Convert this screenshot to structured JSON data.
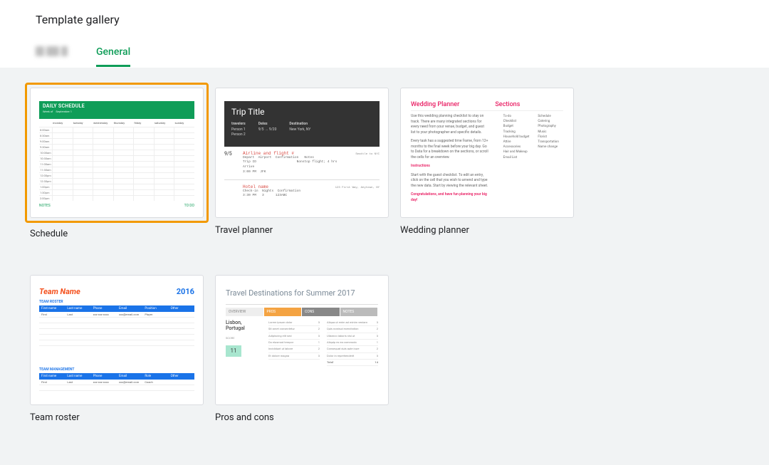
{
  "header": {
    "title": "Template gallery"
  },
  "tabs": [
    {
      "label": "",
      "blurred": true,
      "active": false
    },
    {
      "label": "General",
      "blurred": false,
      "active": true
    }
  ],
  "templates": [
    {
      "id": "schedule",
      "label": "Schedule",
      "selected": true,
      "thumb": {
        "kind": "schedule",
        "title": "DAILY SCHEDULE",
        "accent": "#0f9d58"
      }
    },
    {
      "id": "travel-planner",
      "label": "Travel planner",
      "selected": false,
      "thumb": {
        "kind": "travel",
        "title": "Trip Title",
        "date": "9/5",
        "sections": [
          "Airline and flight #",
          "Hotel name"
        ]
      }
    },
    {
      "id": "wedding-planner",
      "label": "Wedding planner",
      "selected": false,
      "thumb": {
        "kind": "wedding",
        "title": "Wedding Planner",
        "sections_label": "Sections",
        "accent": "#e91e63"
      }
    },
    {
      "id": "team-roster",
      "label": "Team roster",
      "selected": false,
      "thumb": {
        "kind": "roster",
        "team": "Team Name",
        "year": "2016",
        "section1": "TEAM ROSTER",
        "section2": "TEAM MANAGEMENT",
        "columns": [
          "First name",
          "Last name",
          "Phone",
          "Email",
          "Position",
          "Other"
        ]
      }
    },
    {
      "id": "pros-and-cons",
      "label": "Pros and cons",
      "selected": false,
      "thumb": {
        "kind": "proscons",
        "title": "Travel Destinations for Summer 2017",
        "city": "Lisbon, Portugal",
        "score": "11"
      }
    }
  ]
}
